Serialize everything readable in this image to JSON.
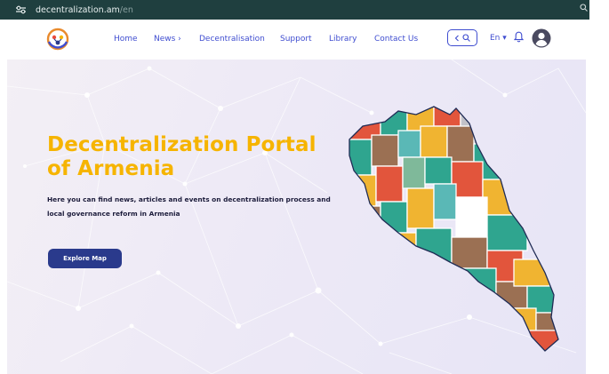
{
  "browser": {
    "url_host": "decentralization.am",
    "url_path": "/en"
  },
  "nav": {
    "items": [
      {
        "label": "Home"
      },
      {
        "label": "News ›"
      },
      {
        "label": "Decentralisation"
      },
      {
        "label": "Support"
      },
      {
        "label": "Library"
      },
      {
        "label": "Contact Us"
      }
    ],
    "language": "En ▾"
  },
  "hero": {
    "title": "Decentralization Portal of Armenia",
    "description": "Here you can find news, articles and events on decentralization process and local governance reform in Armenia",
    "button_label": "Explore Map"
  },
  "icons": {
    "tune": "tune-icon",
    "search": "search-icon",
    "back": "chevron-left-icon",
    "bell": "bell-icon",
    "user": "user-avatar-icon",
    "logo": "portal-logo-icon"
  },
  "colors": {
    "browser_bar": "#1f3f3f",
    "nav_text": "#3f4dd0",
    "hero_title": "#f6b400",
    "button": "#2a3a8c",
    "text_dark": "#1b1b3a"
  }
}
